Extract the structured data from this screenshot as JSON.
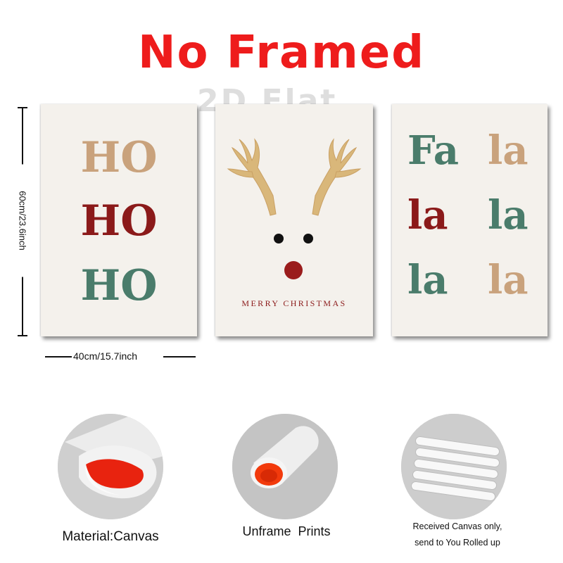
{
  "header": {
    "title": "No Framed",
    "watermark": "2D Flat"
  },
  "colors": {
    "title_red": "#ee1c1c",
    "tan": "#c9a27c",
    "dark_red": "#8b1a1a",
    "teal": "#4a7c6b",
    "gold": "#d9b77a",
    "nose": "#9a1c1c"
  },
  "posters": {
    "left": {
      "lines": [
        "HO",
        "HO",
        "HO"
      ]
    },
    "middle": {
      "caption": "MERRY CHRISTMAS",
      "icon": "reindeer-antlers-icon"
    },
    "right": {
      "words": [
        "Fa",
        "la",
        "la",
        "la",
        "la",
        "la"
      ]
    }
  },
  "dimensions": {
    "height_label": "60cm/23.6inch",
    "width_label": "40cm/15.7inch"
  },
  "features": [
    {
      "caption": "Material:Canvas",
      "icon": "canvas-roll-icon"
    },
    {
      "caption": "Unframe  Prints",
      "icon": "canvas-tube-icon"
    },
    {
      "caption_line1": "Received Canvas only,",
      "caption_line2": "send to You Rolled up",
      "icon": "rolled-canvases-icon"
    }
  ]
}
